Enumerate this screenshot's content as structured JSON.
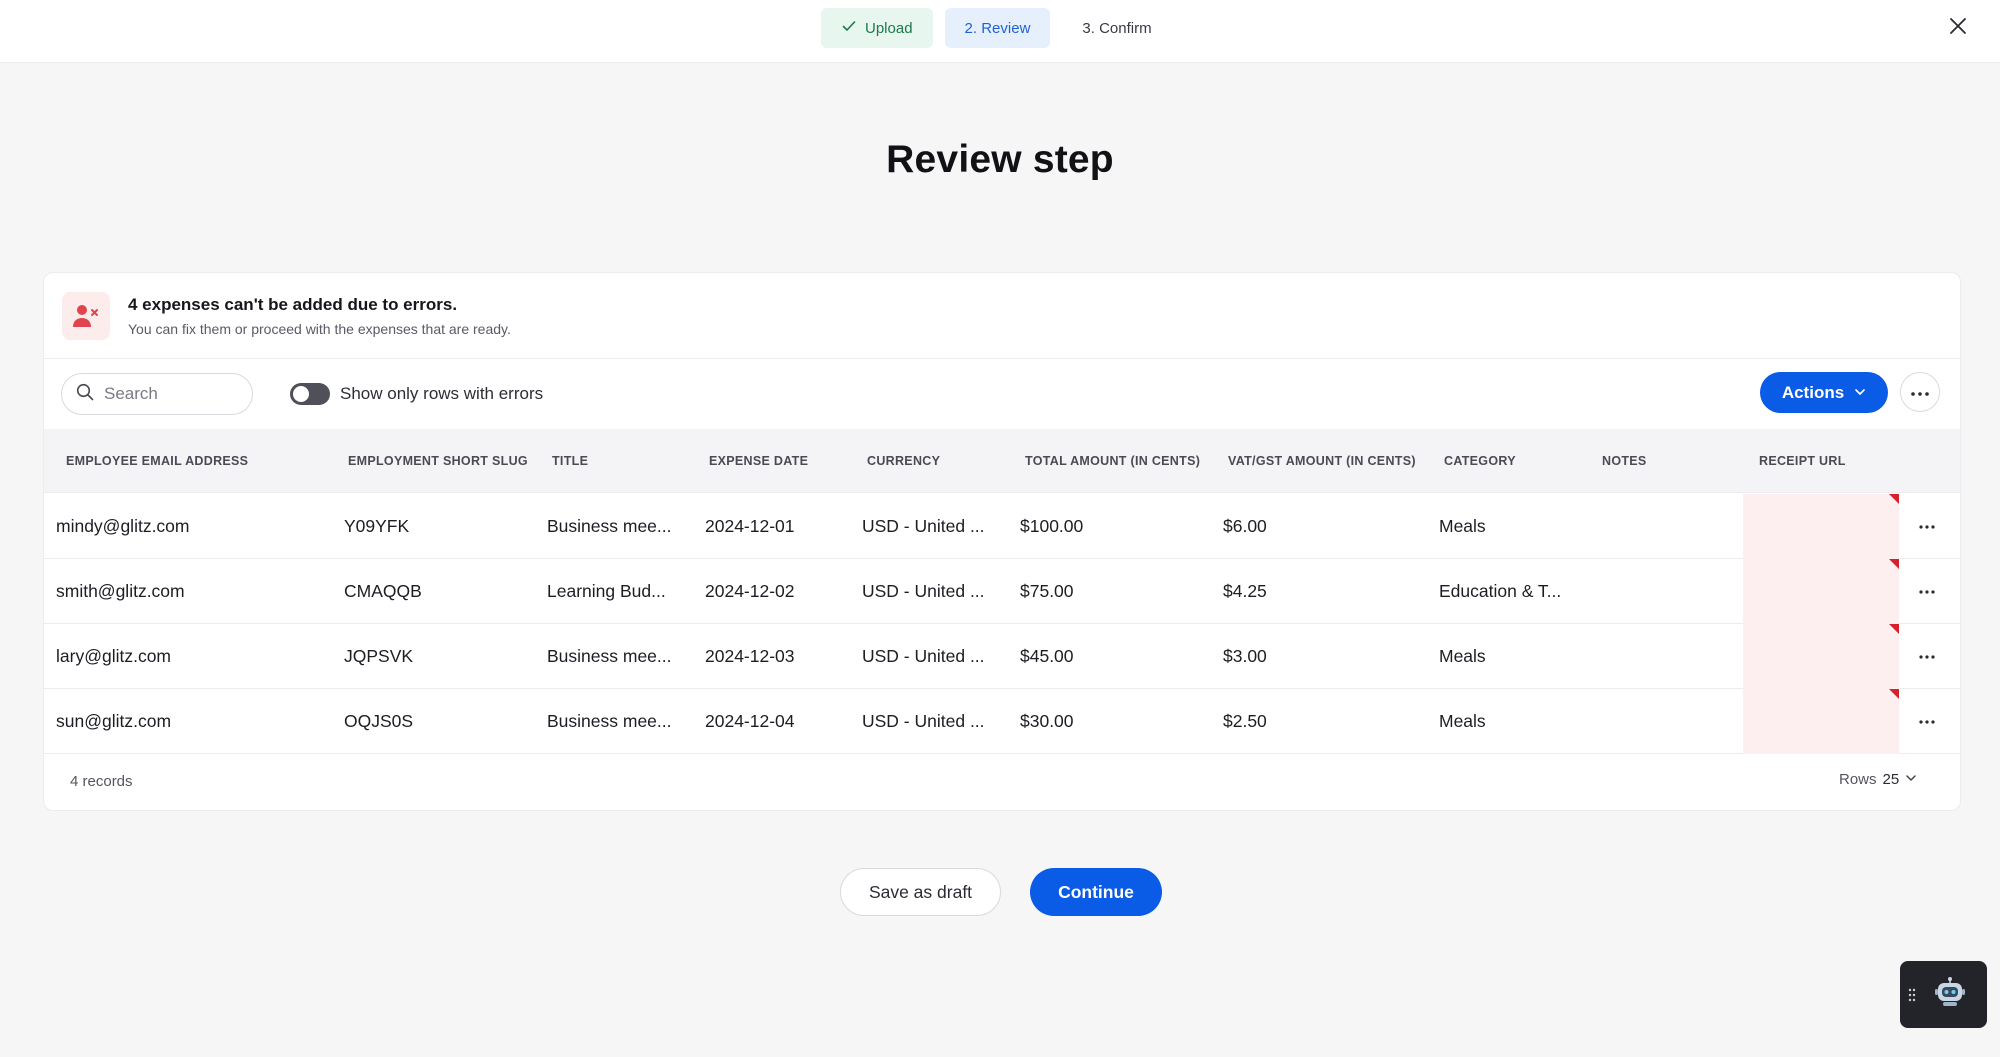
{
  "stepper": {
    "steps": [
      {
        "label": "Upload",
        "status": "done"
      },
      {
        "label": "2.  Review",
        "status": "active"
      },
      {
        "label": "3.  Confirm",
        "status": "pending"
      }
    ]
  },
  "page": {
    "title": "Review step"
  },
  "alert": {
    "title": "4 expenses can't be added due to errors.",
    "subtitle": "You can fix them or proceed with the expenses that are ready."
  },
  "toolbar": {
    "search_placeholder": "Search",
    "toggle_label": "Show only rows with errors",
    "actions_label": "Actions"
  },
  "table": {
    "columns": [
      "EMPLOYEE EMAIL ADDRESS",
      "EMPLOYMENT SHORT SLUG",
      "TITLE",
      "EXPENSE DATE",
      "CURRENCY",
      "TOTAL AMOUNT (IN CENTS)",
      "VAT/GST AMOUNT (IN CENTS)",
      "CATEGORY",
      "NOTES",
      "RECEIPT URL"
    ],
    "rows": [
      [
        "mindy@glitz.com",
        "Y09YFK",
        "Business mee...",
        "2024-12-01",
        "USD - United ...",
        "$100.00",
        "$6.00",
        "Meals",
        "",
        ""
      ],
      [
        "smith@glitz.com",
        "CMAQQB",
        "Learning Bud...",
        "2024-12-02",
        "USD - United ...",
        "$75.00",
        "$4.25",
        "Education & T...",
        "",
        ""
      ],
      [
        "lary@glitz.com",
        "JQPSVK",
        "Business mee...",
        "2024-12-03",
        "USD - United ...",
        "$45.00",
        "$3.00",
        "Meals",
        "",
        ""
      ],
      [
        "sun@glitz.com",
        "OQJS0S",
        "Business mee...",
        "2024-12-04",
        "USD - United ...",
        "$30.00",
        "$2.50",
        "Meals",
        "",
        ""
      ]
    ],
    "records_label": "4 records",
    "rows_per_page_label": "Rows",
    "rows_per_page_value": "25"
  },
  "footer": {
    "save_draft_label": "Save as draft",
    "continue_label": "Continue"
  },
  "colors": {
    "primary": "#0a5be5",
    "error": "#d6202e",
    "error_bg": "#fdeff0",
    "success": "#1d7a4a"
  }
}
